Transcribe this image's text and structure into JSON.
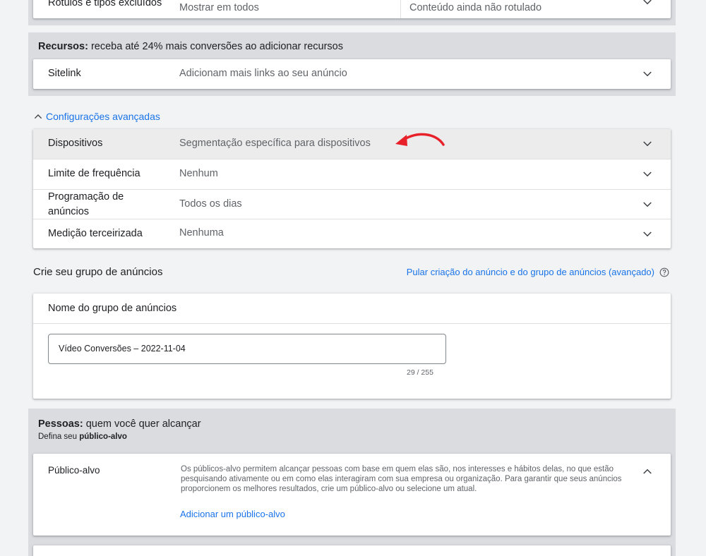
{
  "top_row": {
    "label": "Rótulos e tipos excluídos",
    "value1": "Mostrar em todos",
    "value2": "Conteúdo ainda não rotulado"
  },
  "resources": {
    "title_bold": "Recursos:",
    "title_rest": " receba até 24% mais conversões ao adicionar recursos",
    "sitelink_label": "Sitelink",
    "sitelink_value": "Adicionam mais links ao seu anúncio"
  },
  "advanced": {
    "toggle_label": "Configurações avançadas",
    "rows": [
      {
        "label": "Dispositivos",
        "value": "Segmentação específica para dispositivos"
      },
      {
        "label": "Limite de frequência",
        "value": "Nenhum"
      },
      {
        "label": "Programação de anúncios",
        "value": "Todos os dias"
      },
      {
        "label": "Medição terceirizada",
        "value": "Nenhuma"
      }
    ]
  },
  "ad_group": {
    "heading": "Crie seu grupo de anúncios",
    "skip_link": "Pular criação do anúncio e do grupo de anúncios (avançado)",
    "name_label": "Nome do grupo de anúncios",
    "name_value": "Vídeo Conversões – 2022-11-04",
    "char_count": "29 / 255"
  },
  "people": {
    "title_bold": "Pessoas:",
    "title_rest": " quem você quer alcançar",
    "subtitle_prefix": "Defina seu ",
    "subtitle_bold": "público-alvo",
    "audience_label": "Público-alvo",
    "audience_desc": "Os públicos-alvo permitem alcançar pessoas com base em quem elas são, nos interesses e hábitos delas, no que estão pesquisando ativamente ou em como elas interagiram com sua empresa ou organização. Para garantir que seus anúncios proporcionem os melhores resultados, crie um público-alvo ou selecione um atual.",
    "add_audience_link": "Adicionar um público-alvo"
  },
  "colors": {
    "accent": "#1a73e8",
    "annotation_arrow": "#e8202a"
  }
}
